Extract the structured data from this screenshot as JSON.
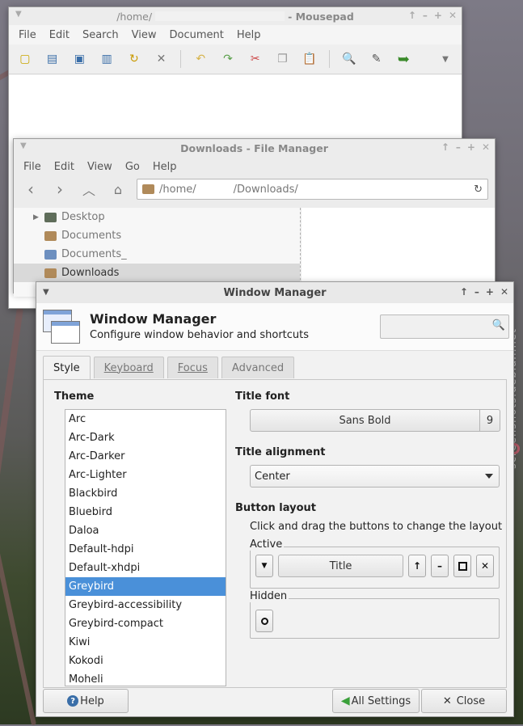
{
  "mousepad": {
    "title_prefix": "/home/",
    "title_suffix": "- Mousepad",
    "menu": [
      "File",
      "Edit",
      "Search",
      "View",
      "Document",
      "Help"
    ],
    "toolbar_icons": [
      "new-file-icon",
      "open-file-icon",
      "save-icon",
      "save-as-icon",
      "reload-icon",
      "close-icon",
      "undo-icon",
      "redo-icon",
      "cut-icon",
      "copy-icon",
      "paste-icon",
      "find-icon",
      "find-replace-icon",
      "goto-icon",
      "overflow-arrow-icon"
    ]
  },
  "filemanager": {
    "title": "Downloads - File Manager",
    "menu": [
      "File",
      "Edit",
      "View",
      "Go",
      "Help"
    ],
    "location_prefix": "/home/",
    "location_suffix": "/Downloads/",
    "side_items": [
      {
        "label": "Desktop",
        "selected": false
      },
      {
        "label": "Documents",
        "selected": false
      },
      {
        "label": "Documents_",
        "selected": false
      },
      {
        "label": "Downloads",
        "selected": true
      }
    ]
  },
  "window_manager": {
    "title": "Window Manager",
    "header_title": "Window Manager",
    "header_subtitle": "Configure window behavior and shortcuts",
    "tabs": [
      "Style",
      "Keyboard",
      "Focus",
      "Advanced"
    ],
    "active_tab": "Style",
    "theme_label": "Theme",
    "themes": [
      "Arc",
      "Arc-Dark",
      "Arc-Darker",
      "Arc-Lighter",
      "Blackbird",
      "Bluebird",
      "Daloa",
      "Default-hdpi",
      "Default-xhdpi",
      "Greybird",
      "Greybird-accessibility",
      "Greybird-compact",
      "Kiwi",
      "Kokodi",
      "Moheli"
    ],
    "selected_theme": "Greybird",
    "title_font_label": "Title font",
    "title_font_name": "Sans Bold",
    "title_font_size": "9",
    "title_alignment_label": "Title alignment",
    "title_alignment_value": "Center",
    "button_layout_label": "Button layout",
    "button_layout_hint": "Click and drag the buttons to change the layout",
    "active_label": "Active",
    "title_button_label": "Title",
    "hidden_label": "Hidden",
    "help_button": "Help",
    "all_settings_button": "All Settings",
    "close_button": "Close"
  },
  "watermark": "screenshots.debian.net"
}
